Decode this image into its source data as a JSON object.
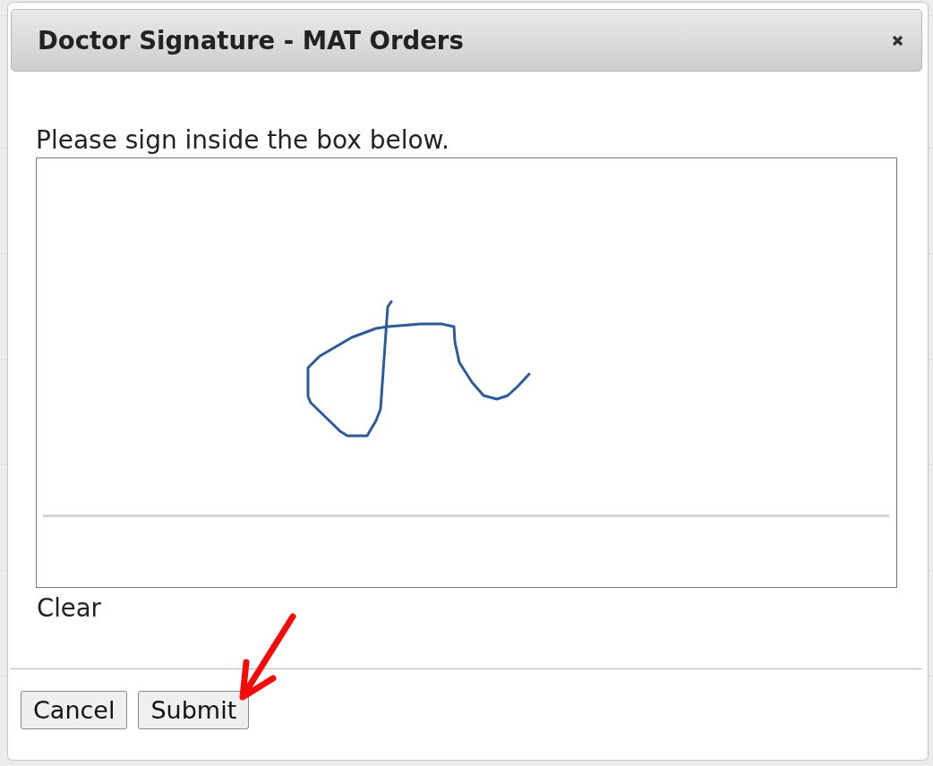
{
  "dialog": {
    "title": "Doctor Signature - MAT Orders"
  },
  "instruction": "Please sign inside the box below.",
  "signature_pad": {
    "signed": true
  },
  "clear_link": "Clear",
  "buttons": [
    {
      "label": "Cancel"
    },
    {
      "label": "Submit"
    }
  ]
}
